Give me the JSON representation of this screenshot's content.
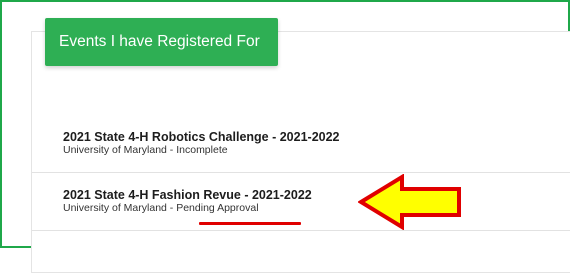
{
  "header": {
    "title": "Events I have Registered For"
  },
  "events": [
    {
      "title": "2021 State 4-H Robotics Challenge - 2021-2022",
      "university": "University of Maryland",
      "separator": " - ",
      "status": "Incomplete"
    },
    {
      "title": "2021 State 4-H Fashion Revue - 2021-2022",
      "university": "University of Maryland",
      "separator": " - ",
      "status": "Pending Approval"
    }
  ],
  "colors": {
    "border_green": "#1fa84a",
    "badge_green": "#2eaf54",
    "annotation_red": "#e00000",
    "annotation_yellow": "#ffff00"
  }
}
